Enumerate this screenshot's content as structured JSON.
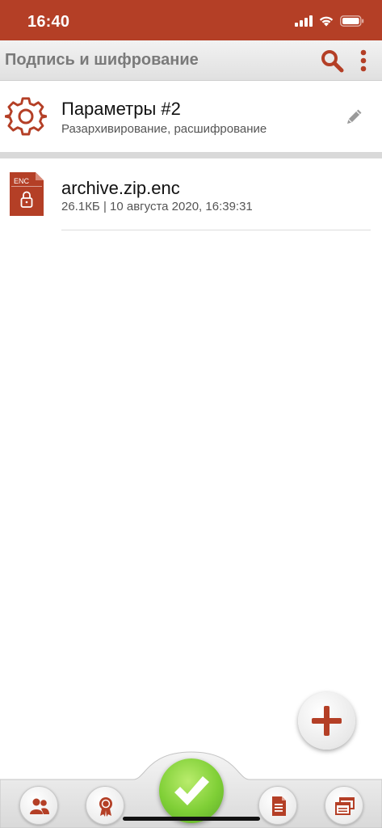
{
  "status_bar": {
    "time": "16:40"
  },
  "toolbar": {
    "title": "Подпись и шифрование"
  },
  "params": {
    "title": "Параметры #2",
    "subtitle": "Разархивирование, расшифрование"
  },
  "file": {
    "badge": "ENC",
    "name": "archive.zip.enc",
    "meta": "26.1КБ | 10 августа 2020, 16:39:31"
  },
  "bottom_nav": [
    {
      "icon": "contacts-icon"
    },
    {
      "icon": "certificate-icon"
    },
    {
      "icon": "confirm-check-icon"
    },
    {
      "icon": "document-icon"
    },
    {
      "icon": "windows-icon"
    }
  ],
  "colors": {
    "accent": "#b43f26",
    "confirm": "#7fcf36"
  }
}
